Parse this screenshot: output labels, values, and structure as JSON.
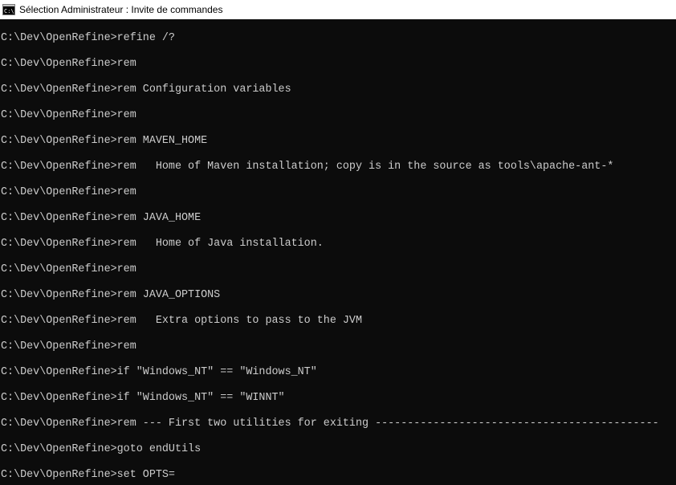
{
  "window": {
    "title": "Sélection Administrateur : Invite de commandes",
    "icon": "cmd-icon"
  },
  "console": {
    "lines": [
      "C:\\Dev\\OpenRefine>refine /?",
      "C:\\Dev\\OpenRefine>rem",
      "C:\\Dev\\OpenRefine>rem Configuration variables",
      "C:\\Dev\\OpenRefine>rem",
      "C:\\Dev\\OpenRefine>rem MAVEN_HOME",
      "C:\\Dev\\OpenRefine>rem   Home of Maven installation; copy is in the source as tools\\apache-ant-*",
      "C:\\Dev\\OpenRefine>rem",
      "C:\\Dev\\OpenRefine>rem JAVA_HOME",
      "C:\\Dev\\OpenRefine>rem   Home of Java installation.",
      "C:\\Dev\\OpenRefine>rem",
      "C:\\Dev\\OpenRefine>rem JAVA_OPTIONS",
      "C:\\Dev\\OpenRefine>rem   Extra options to pass to the JVM",
      "C:\\Dev\\OpenRefine>rem",
      "C:\\Dev\\OpenRefine>if \"Windows_NT\" == \"Windows_NT\"",
      "C:\\Dev\\OpenRefine>if \"Windows_NT\" == \"WINNT\"",
      "C:\\Dev\\OpenRefine>rem --- First two utilities for exiting --------------------------------------------",
      "C:\\Dev\\OpenRefine>goto endUtils",
      "C:\\Dev\\OpenRefine>set OPTS="
    ]
  },
  "colors": {
    "console_bg": "#0c0c0c",
    "console_fg": "#cccccc",
    "titlebar_bg": "#ffffff",
    "title_fg": "#000000"
  }
}
